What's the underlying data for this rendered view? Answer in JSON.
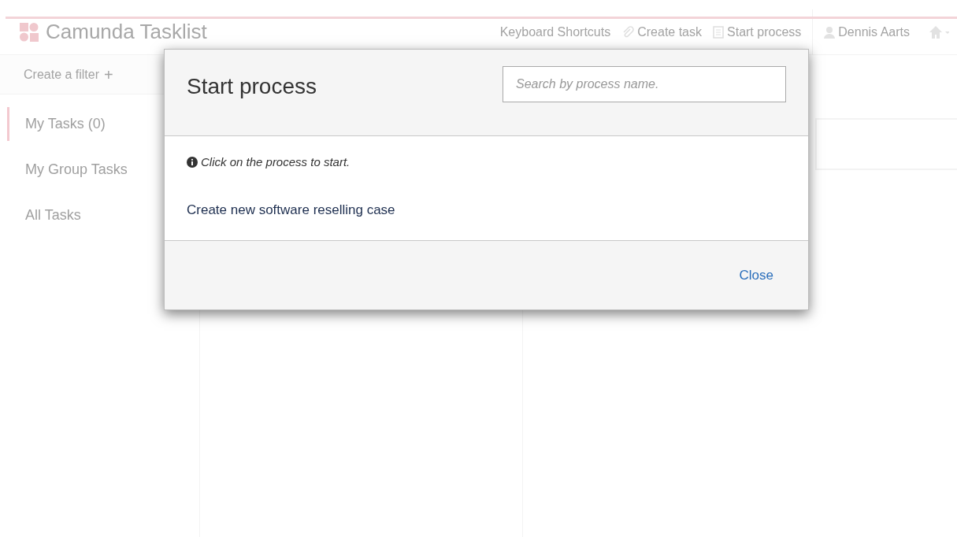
{
  "app": {
    "title": "Camunda Tasklist"
  },
  "nav": [
    {
      "kind": "text",
      "label": "Keyboard Shortcuts"
    },
    {
      "kind": "attach",
      "label": "Create task"
    },
    {
      "kind": "list",
      "label": "Start process"
    }
  ],
  "user": {
    "name": "Dennis Aarts"
  },
  "filter_bar": {
    "label": "Create a filter",
    "add": "+"
  },
  "sidebar": {
    "items": [
      {
        "label": "My Tasks (0)",
        "selected": true
      },
      {
        "label": "My Group Tasks",
        "selected": false
      },
      {
        "label": "All Tasks",
        "selected": false
      }
    ]
  },
  "dialog": {
    "title": "Start process",
    "search": {
      "placeholder": "Search by process name."
    },
    "hint": "Click on the process to start.",
    "processes": [
      "Create new software reselling case"
    ],
    "close": "Close"
  }
}
